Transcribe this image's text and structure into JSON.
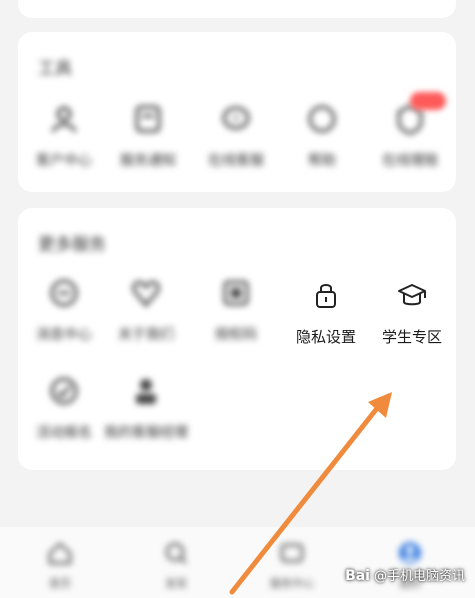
{
  "colors": {
    "accent": "#f08a3c",
    "badge": "#ff5a5a"
  },
  "tools_card": {
    "title": "工具",
    "items": [
      {
        "label": "客户中心",
        "icon": "person-icon"
      },
      {
        "label": "服务通知",
        "icon": "notice-icon"
      },
      {
        "label": "在线客服",
        "icon": "chat-icon"
      },
      {
        "label": "帮助",
        "icon": "help-icon"
      },
      {
        "label": "在线理赔",
        "icon": "claim-icon"
      }
    ]
  },
  "more_card": {
    "title": "更多服务",
    "items": [
      {
        "label": "消息中心",
        "icon": "message-icon"
      },
      {
        "label": "关于我们",
        "icon": "heart-icon"
      },
      {
        "label": "授权码",
        "icon": "qr-icon"
      },
      {
        "label": "隐私设置",
        "icon": "lock-icon"
      },
      {
        "label": "学生专区",
        "icon": "graduation-cap-icon"
      },
      {
        "label": "活动报名",
        "icon": "signup-icon"
      },
      {
        "label": "我的客服经理",
        "icon": "manager-icon"
      }
    ]
  },
  "nav": {
    "tabs": [
      {
        "label": "首页",
        "icon": "home-icon"
      },
      {
        "label": "发现",
        "icon": "discover-icon"
      },
      {
        "label": "服务中心",
        "icon": "service-icon"
      },
      {
        "label": "我的",
        "icon": "profile-icon"
      }
    ]
  },
  "watermark": {
    "logo": "Bai",
    "text": "@手机电脑资讯"
  }
}
